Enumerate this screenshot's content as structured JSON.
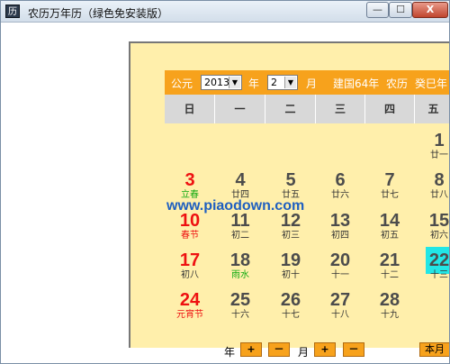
{
  "window": {
    "title": "农历万年历（绿色免安装版）",
    "icon": "calendar-icon"
  },
  "window_buttons": {
    "minimize": "—",
    "maximize": "☐",
    "close": "X"
  },
  "header": {
    "era_label": "公元",
    "year_value": "2013",
    "year_unit": "年",
    "month_value": "2",
    "month_unit": "月",
    "ming_guo": "建国64年",
    "lunar_label": "农历",
    "lunar_year": "癸巳年"
  },
  "weekdays": [
    "日",
    "一",
    "二",
    "三",
    "四",
    "五"
  ],
  "days": {
    "d1": {
      "num": "1",
      "lunar": "廿一"
    },
    "d3": {
      "num": "3",
      "lunar": "立春"
    },
    "d4": {
      "num": "4",
      "lunar": "廿四"
    },
    "d5": {
      "num": "5",
      "lunar": "廿五"
    },
    "d6": {
      "num": "6",
      "lunar": "廿六"
    },
    "d7": {
      "num": "7",
      "lunar": "廿七"
    },
    "d8": {
      "num": "8",
      "lunar": "廿八"
    },
    "d10": {
      "num": "10",
      "lunar": "春节"
    },
    "d11": {
      "num": "11",
      "lunar": "初二"
    },
    "d12": {
      "num": "12",
      "lunar": "初三"
    },
    "d13": {
      "num": "13",
      "lunar": "初四"
    },
    "d14": {
      "num": "14",
      "lunar": "初五"
    },
    "d15": {
      "num": "15",
      "lunar": "初六"
    },
    "d17": {
      "num": "17",
      "lunar": "初八"
    },
    "d18": {
      "num": "18",
      "lunar": "雨水"
    },
    "d19": {
      "num": "19",
      "lunar": "初十"
    },
    "d20": {
      "num": "20",
      "lunar": "十一"
    },
    "d21": {
      "num": "21",
      "lunar": "十二"
    },
    "d22": {
      "num": "22",
      "lunar": "十三"
    },
    "d24": {
      "num": "24",
      "lunar": "元宵节"
    },
    "d25": {
      "num": "25",
      "lunar": "十六"
    },
    "d26": {
      "num": "26",
      "lunar": "十七"
    },
    "d27": {
      "num": "27",
      "lunar": "十八"
    },
    "d28": {
      "num": "28",
      "lunar": "十九"
    }
  },
  "watermark": "www.piaodown.com",
  "footer": {
    "year_label": "年",
    "plus": "+",
    "minus": "－",
    "month_label": "月",
    "this_month": "本月"
  },
  "colors": {
    "header_orange": "#f7a21c",
    "panel_yellow": "#ffefab",
    "holiday_red": "#ee1111",
    "solar_term_green": "#11aa11",
    "today_cyan": "#22e6e6"
  }
}
